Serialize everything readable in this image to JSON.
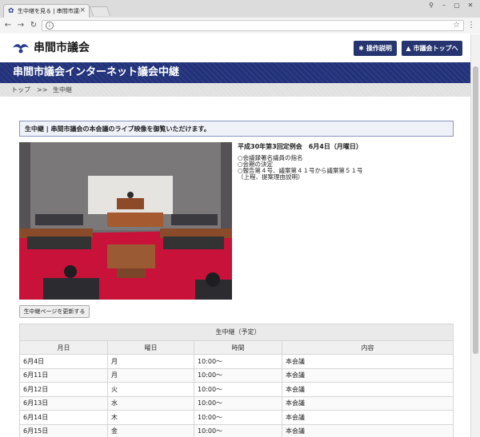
{
  "browser": {
    "tab_title": "生中継を見る | 串間市議会",
    "tab_close": "×",
    "info_icon": "i"
  },
  "site": {
    "name": "串間市議会",
    "buttons": {
      "help": "操作説明",
      "top": "市議会トップへ"
    },
    "banner_title": "串間市議会インターネット議会中継",
    "breadcrumb": {
      "top": "トップ",
      "separator": ">>",
      "current": "生中継"
    }
  },
  "notice": "生中継 | 串間市議会の本会議のライブ映像を御覧いただけます。",
  "session": {
    "title": "平成30年第3回定例会　6月4日（月曜日）",
    "agenda": [
      "○会議録署名議員の指名",
      "○会期の決定",
      "○報告第４号、議案第４１号から議案第５１号",
      "（上程、提案理由説明）"
    ]
  },
  "refresh_button": "生中継ページを更新する",
  "schedule": {
    "caption": "生中継（予定）",
    "headers": [
      "月日",
      "曜日",
      "時間",
      "内容"
    ],
    "rows": [
      [
        "6月4日",
        "月",
        "10:00～",
        "本会議"
      ],
      [
        "6月11日",
        "月",
        "10:00～",
        "本会議"
      ],
      [
        "6月12日",
        "火",
        "10:00～",
        "本会議"
      ],
      [
        "6月13日",
        "水",
        "10:00～",
        "本会議"
      ],
      [
        "6月14日",
        "木",
        "10:00～",
        "本会議"
      ],
      [
        "6月15日",
        "金",
        "10:00～",
        "本会議"
      ]
    ]
  },
  "colors": {
    "brand_navy": "#22327a",
    "button_navy": "#263570",
    "carpet_red": "#c8123a"
  }
}
